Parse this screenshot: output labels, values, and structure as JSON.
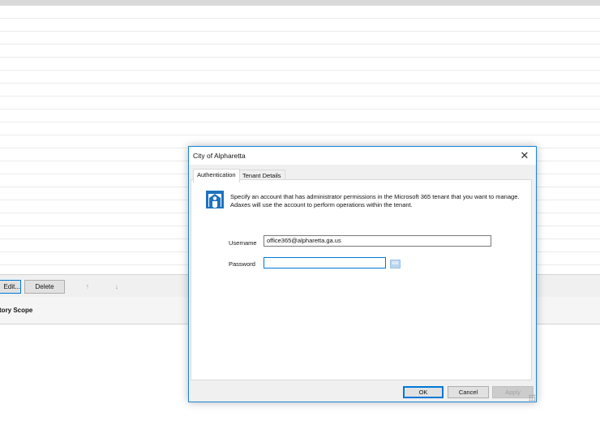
{
  "background": {
    "toolbar": {
      "edit_label": "Edit...",
      "delete_label": "Delete",
      "up_icon": "arrow-up-icon",
      "down_icon": "arrow-down-icon"
    },
    "scope_label": "Directory Scope"
  },
  "dialog": {
    "title": "City of Alpharetta",
    "close_glyph": "✕",
    "tabs": [
      {
        "label": "Authentication",
        "active": true
      },
      {
        "label": "Tenant Details",
        "active": false
      }
    ],
    "intro_text": "Specify an account that has administrator permissions in the Microsoft 365 tenant that you want to manage. Adaxes will use the account to perform operations within the tenant.",
    "username": {
      "label": "Username",
      "value": "office365@alpharetta.ga.us"
    },
    "password": {
      "label": "Password",
      "value": ""
    },
    "keyboard_language": "EN",
    "buttons": {
      "ok": "OK",
      "cancel": "Cancel",
      "apply": "Apply"
    }
  },
  "colors": {
    "accent": "#0078d7",
    "dialog_border": "#1883d7",
    "logo_blue": "#1e73be"
  }
}
